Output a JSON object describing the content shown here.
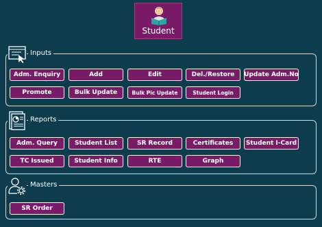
{
  "header": {
    "label": "Student",
    "icon": "student-reading-icon"
  },
  "colors": {
    "background": "#0d3d4d",
    "button": "#7a1b6a",
    "button_border": "#ffffff"
  },
  "sections": {
    "inputs": {
      "title": "Inputs",
      "icon": "input-form-icon",
      "buttons": [
        "Adm. Enquiry",
        "Add",
        "Edit",
        "Del./Restore",
        "Update Adm.No",
        "Promote",
        "Bulk Update",
        "Bulk Pic Update",
        "Student Login"
      ]
    },
    "reports": {
      "title": "Reports",
      "icon": "report-document-icon",
      "buttons": [
        "Adm. Query",
        "Student List",
        "SR Record",
        "Certificates",
        "Student I-Card",
        "TC Issued",
        "Student Info",
        "RTE",
        "Graph"
      ]
    },
    "masters": {
      "title": "Masters",
      "icon": "user-settings-icon",
      "buttons": [
        "SR Order"
      ]
    }
  }
}
